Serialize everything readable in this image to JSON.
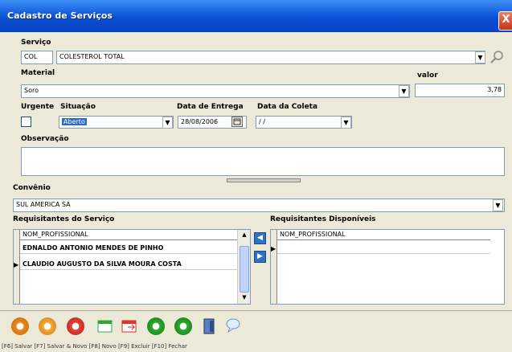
{
  "window": {
    "title": "Cadastro de Serviços",
    "close_glyph": "X"
  },
  "servico": {
    "label": "Serviço",
    "code": "COL",
    "name": "COLESTEROL TOTAL"
  },
  "material": {
    "label": "Material",
    "value": "Soro"
  },
  "valor": {
    "label": "valor",
    "value": "3,78"
  },
  "urgente": {
    "label": "Urgente"
  },
  "situacao": {
    "label": "Situação",
    "value": "Aberto"
  },
  "data_entrega": {
    "label": "Data de Entrega",
    "value": "28/08/2006"
  },
  "data_coleta": {
    "label": "Data da Coleta",
    "value": "/ /"
  },
  "observacao": {
    "label": "Observação",
    "value": ""
  },
  "convenio": {
    "label": "Convênio",
    "value": "SUL AMERICA SA"
  },
  "requisitantes": {
    "label": "Requisitantes do Serviço",
    "column": "NOM_PROFISSIONAL",
    "rows": [
      "EDNALDO ANTONIO MENDES DE PINHO",
      "CLAUDIO AUGUSTO DA SILVA MOURA COSTA"
    ]
  },
  "disponiveis": {
    "label": "Requisitantes Disponíveis",
    "column": "NOM_PROFISSIONAL"
  },
  "status_bar": {
    "text": "[F6] Salvar [F7] Salvar & Novo [F8] Novo [F9] Excluir [F10] Fechar"
  },
  "colors": {
    "title_bar": "#0a4fd6",
    "selection": "#316ac5",
    "toolbar_green": "#2ea82e",
    "toolbar_orange": "#e88a1a"
  }
}
